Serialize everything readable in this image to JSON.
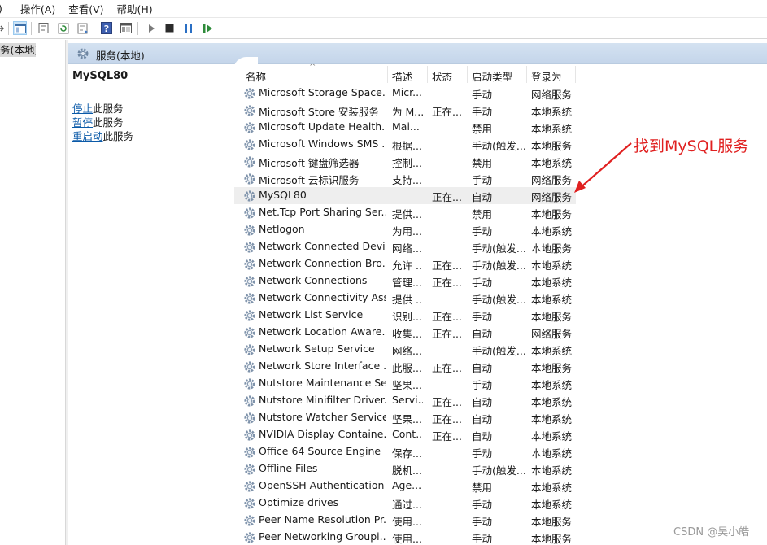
{
  "menu": [
    "操作(A)",
    "查看(V)",
    "帮助(H)"
  ],
  "tree": {
    "selected": "务(本地)"
  },
  "header_band": {
    "title": "服务(本地)"
  },
  "details": {
    "service_name": "MySQL80",
    "actions": [
      {
        "link": "停止",
        "rest": "此服务"
      },
      {
        "link": "暂停",
        "rest": "此服务"
      },
      {
        "link": "重启动",
        "rest": "此服务"
      }
    ]
  },
  "columns": {
    "name": "名称",
    "desc": "描述",
    "status": "状态",
    "startup": "启动类型",
    "logon": "登录为"
  },
  "rows": [
    {
      "name": "Microsoft Storage Space...",
      "desc": "Micr...",
      "status": "",
      "startup": "手动",
      "logon": "网络服务"
    },
    {
      "name": "Microsoft Store 安装服务",
      "desc": "为 M...",
      "status": "正在...",
      "startup": "手动",
      "logon": "本地系统"
    },
    {
      "name": "Microsoft Update Health...",
      "desc": "Mai...",
      "status": "",
      "startup": "禁用",
      "logon": "本地系统"
    },
    {
      "name": "Microsoft Windows SMS ...",
      "desc": "根据...",
      "status": "",
      "startup": "手动(触发...",
      "logon": "本地服务"
    },
    {
      "name": "Microsoft 键盘筛选器",
      "desc": "控制...",
      "status": "",
      "startup": "禁用",
      "logon": "本地系统"
    },
    {
      "name": "Microsoft 云标识服务",
      "desc": "支持...",
      "status": "",
      "startup": "手动",
      "logon": "网络服务"
    },
    {
      "name": "MySQL80",
      "desc": "",
      "status": "正在...",
      "startup": "自动",
      "logon": "网络服务"
    },
    {
      "name": "Net.Tcp Port Sharing Ser...",
      "desc": "提供...",
      "status": "",
      "startup": "禁用",
      "logon": "本地服务"
    },
    {
      "name": "Netlogon",
      "desc": "为用...",
      "status": "",
      "startup": "手动",
      "logon": "本地系统"
    },
    {
      "name": "Network Connected Devi...",
      "desc": "网络...",
      "status": "",
      "startup": "手动(触发...",
      "logon": "本地服务"
    },
    {
      "name": "Network Connection Bro...",
      "desc": "允许 ...",
      "status": "正在...",
      "startup": "手动(触发...",
      "logon": "本地系统"
    },
    {
      "name": "Network Connections",
      "desc": "管理...",
      "status": "正在...",
      "startup": "手动",
      "logon": "本地系统"
    },
    {
      "name": "Network Connectivity Ass...",
      "desc": "提供 ...",
      "status": "",
      "startup": "手动(触发...",
      "logon": "本地系统"
    },
    {
      "name": "Network List Service",
      "desc": "识别...",
      "status": "正在...",
      "startup": "手动",
      "logon": "本地服务"
    },
    {
      "name": "Network Location Aware...",
      "desc": "收集...",
      "status": "正在...",
      "startup": "自动",
      "logon": "网络服务"
    },
    {
      "name": "Network Setup Service",
      "desc": "网络...",
      "status": "",
      "startup": "手动(触发...",
      "logon": "本地系统"
    },
    {
      "name": "Network Store Interface ...",
      "desc": "此服...",
      "status": "正在...",
      "startup": "自动",
      "logon": "本地服务"
    },
    {
      "name": "Nutstore Maintenance Se...",
      "desc": "坚果...",
      "status": "",
      "startup": "手动",
      "logon": "本地系统"
    },
    {
      "name": "Nutstore Minifilter Driver...",
      "desc": "Servi...",
      "status": "正在...",
      "startup": "自动",
      "logon": "本地系统"
    },
    {
      "name": "Nutstore Watcher Service",
      "desc": "坚果...",
      "status": "正在...",
      "startup": "自动",
      "logon": "本地系统"
    },
    {
      "name": "NVIDIA Display Containe...",
      "desc": "Cont...",
      "status": "正在...",
      "startup": "自动",
      "logon": "本地系统"
    },
    {
      "name": "Office 64 Source Engine",
      "desc": "保存...",
      "status": "",
      "startup": "手动",
      "logon": "本地系统"
    },
    {
      "name": "Offline Files",
      "desc": "脱机...",
      "status": "",
      "startup": "手动(触发...",
      "logon": "本地系统"
    },
    {
      "name": "OpenSSH Authentication ...",
      "desc": "Age...",
      "status": "",
      "startup": "禁用",
      "logon": "本地系统"
    },
    {
      "name": "Optimize drives",
      "desc": "通过...",
      "status": "",
      "startup": "手动",
      "logon": "本地系统"
    },
    {
      "name": "Peer Name Resolution Pr...",
      "desc": "使用...",
      "status": "",
      "startup": "手动",
      "logon": "本地服务"
    },
    {
      "name": "Peer Networking Groupi...",
      "desc": "使用...",
      "status": "",
      "startup": "手动",
      "logon": "本地服务"
    }
  ],
  "highlight_row_index": 6,
  "annotation": {
    "text": "找到MySQL服务",
    "color": "#e02020"
  },
  "watermark": "CSDN @吴小皓"
}
